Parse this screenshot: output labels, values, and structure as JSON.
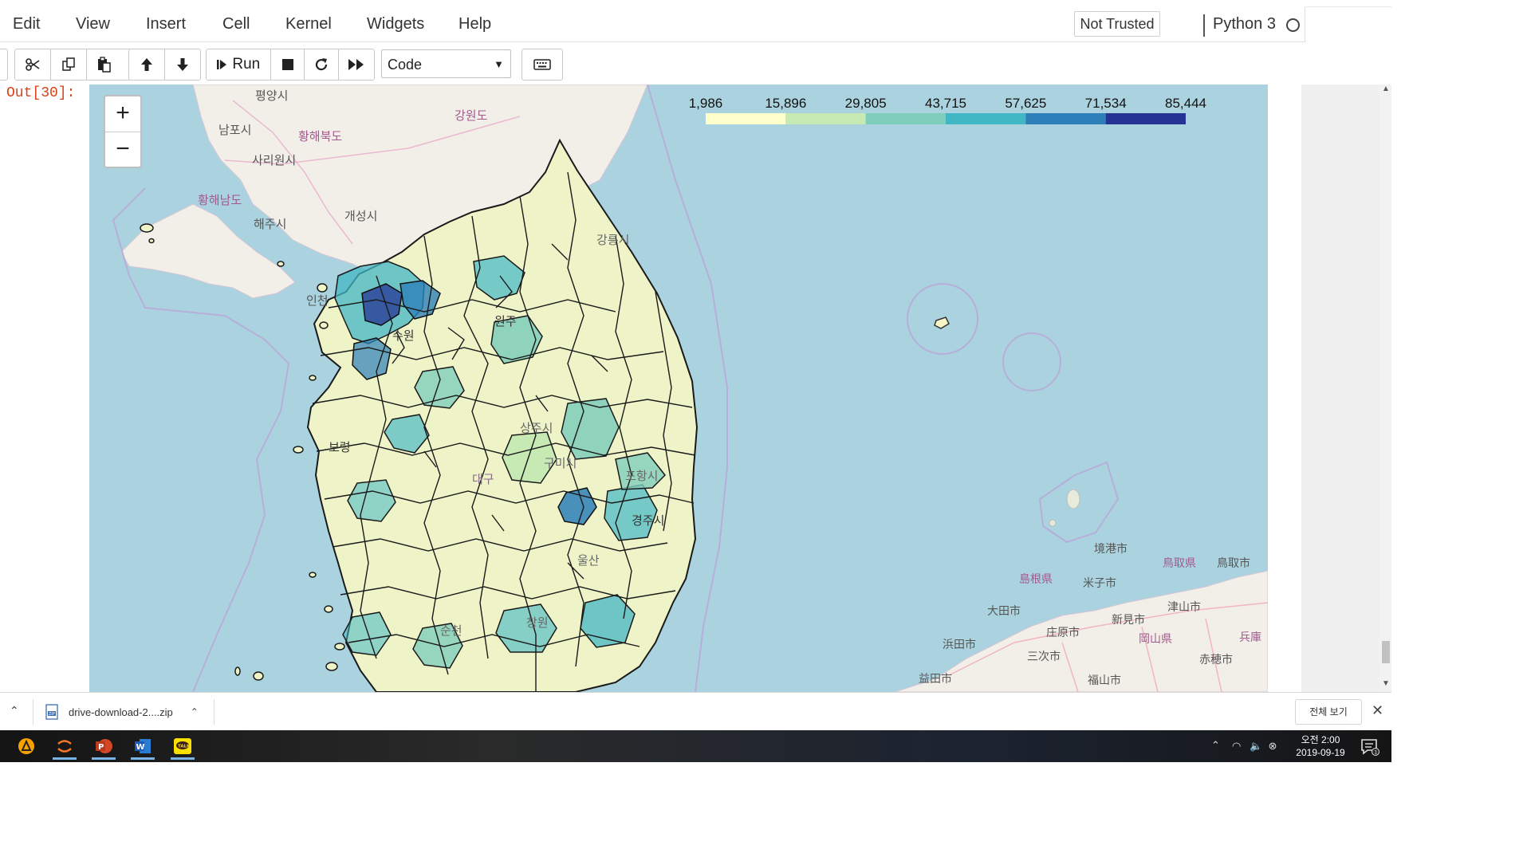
{
  "menubar": {
    "items": [
      "Edit",
      "View",
      "Insert",
      "Cell",
      "Kernel",
      "Widgets",
      "Help"
    ],
    "trusted": "Not Trusted",
    "kernel": "Python 3"
  },
  "toolbar": {
    "run_label": "Run",
    "cell_type": "Code",
    "icons": [
      "cut-icon",
      "copy-icon",
      "paste-icon",
      "move-up-icon",
      "move-down-icon",
      "run-icon",
      "stop-icon",
      "restart-icon",
      "fast-forward-icon",
      "keyboard-icon"
    ]
  },
  "output": {
    "prompt": "Out[30]:"
  },
  "map": {
    "colorscale": {
      "ticks": [
        "1,986",
        "15,896",
        "29,805",
        "43,715",
        "57,625",
        "71,534",
        "85,444"
      ],
      "colors": [
        "#ffffcc",
        "#c7e9b4",
        "#7fcdbb",
        "#41b6c4",
        "#2c7fb8",
        "#253494"
      ]
    },
    "zoom_in": "+",
    "zoom_out": "−",
    "place_labels": {
      "north_korea": [
        "평양시",
        "남포시",
        "황해북도",
        "사리원시",
        "황해남도",
        "해주시",
        "개성시",
        "강원도"
      ],
      "south_korea": [
        "인천",
        "수원",
        "원주",
        "강릉시",
        "상주시",
        "구미시",
        "대구",
        "포항시",
        "경주시",
        "울산",
        "창원",
        "순천",
        "보령"
      ],
      "japan": [
        "境港市",
        "鳥取県",
        "鳥取市",
        "島根県",
        "米子市",
        "大田市",
        "新見市",
        "津山市",
        "庄原市",
        "岡山県",
        "浜田市",
        "三次市",
        "赤穂市",
        "益田市",
        "福山市",
        "兵庫"
      ]
    }
  },
  "downloads": {
    "file": "drive-download-2....zip",
    "show_all": "전체 보기"
  },
  "taskbar": {
    "apps": [
      "avast-icon",
      "jupyter-icon",
      "powerpoint-icon",
      "word-icon",
      "kakaotalk-icon"
    ],
    "time": "오전 2:00",
    "date": "2019-09-19",
    "notification_count": "1"
  }
}
